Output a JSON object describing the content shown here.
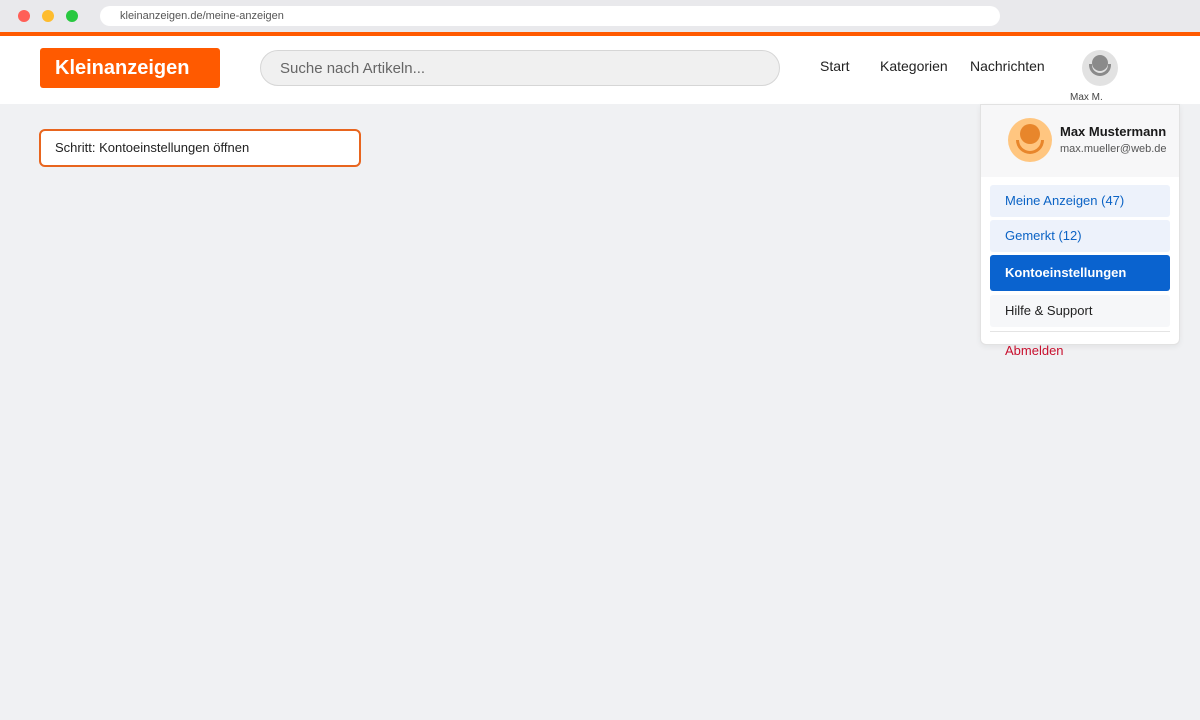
{
  "browser": {
    "url": "kleinanzeigen.de/meine-anzeigen"
  },
  "header": {
    "logo": "Kleinanzeigen",
    "search_placeholder": "Suche nach Artikeln...",
    "nav": {
      "start": "Start",
      "kategorien": "Kategorien",
      "nachrichten": "Nachrichten"
    },
    "user_short": "Max M."
  },
  "step": {
    "text": "Schritt: Kontoeinstellungen öffnen"
  },
  "dropdown": {
    "name": "Max Mustermann",
    "email": "max.mueller@web.de",
    "items": {
      "meine_anzeigen": "Meine Anzeigen (47)",
      "gemerkt": "Gemerkt (12)",
      "kontoeinstellungen": "Kontoeinstellungen",
      "hilfe": "Hilfe & Support"
    },
    "logout": "Abmelden"
  },
  "colors": {
    "brand": "#ff5a00",
    "active": "#0a63cf",
    "link": "#0b63c5",
    "danger": "#c8102e"
  }
}
